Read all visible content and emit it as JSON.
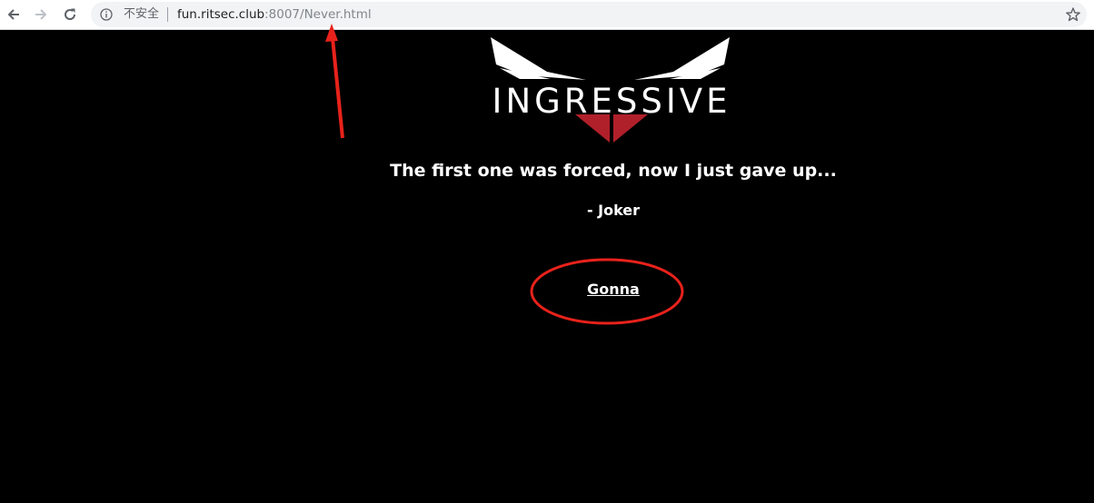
{
  "browser": {
    "security_label": "不安全",
    "url_host": "fun.ritsec.club",
    "url_rest": ":8007/Never.html"
  },
  "page": {
    "logo_text": "INGRESSIVE",
    "quote": "The first one was forced, now I just gave up...",
    "author": "- Joker",
    "link_label": "Gonna"
  },
  "colors": {
    "page_background": "#000000",
    "text": "#ffffff",
    "logo_accent": "#b0202a",
    "annotation": "#e8221b"
  }
}
